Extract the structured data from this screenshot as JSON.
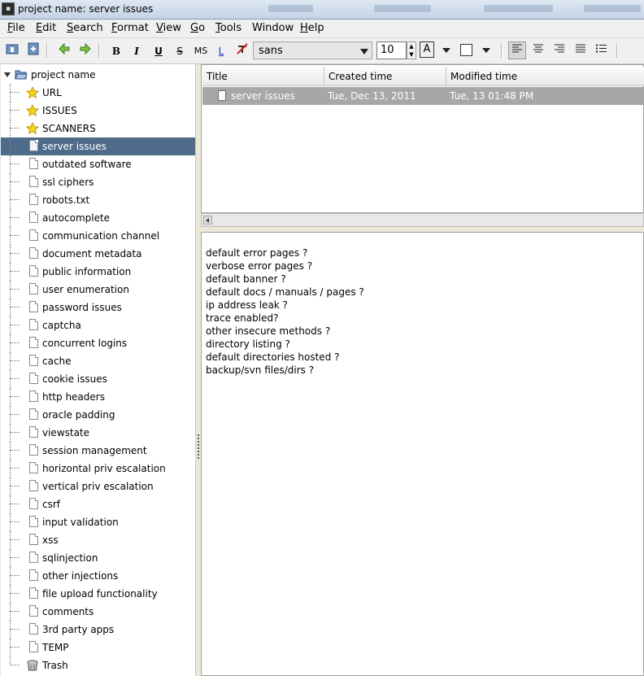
{
  "window": {
    "title": "project name: server issues"
  },
  "menu": [
    {
      "accel": "F",
      "rest": "ile"
    },
    {
      "accel": "E",
      "rest": "dit"
    },
    {
      "accel": "S",
      "rest": "earch"
    },
    {
      "accel": "F",
      "rest": "ormat",
      "prefix": ""
    },
    {
      "accel": "V",
      "rest": "iew"
    },
    {
      "accel": "G",
      "rest": "o"
    },
    {
      "accel": "T",
      "rest": "ools"
    },
    {
      "accel": "",
      "rest": "Window"
    },
    {
      "accel": "H",
      "rest": "elp"
    }
  ],
  "toolbar": {
    "bold": "B",
    "italic": "I",
    "underline": "U",
    "strike": "S",
    "mono": "MS",
    "link": "L",
    "font": "sans",
    "size": "10",
    "text_color": "A"
  },
  "tree": {
    "root": "project name",
    "items": [
      {
        "label": "URL",
        "icon": "star-icon"
      },
      {
        "label": "ISSUES",
        "icon": "star-icon"
      },
      {
        "label": "SCANNERS",
        "icon": "star-icon"
      },
      {
        "label": "server issues",
        "icon": "page-icon",
        "selected": true
      },
      {
        "label": "outdated software",
        "icon": "page-icon"
      },
      {
        "label": "ssl ciphers",
        "icon": "page-icon"
      },
      {
        "label": "robots.txt",
        "icon": "page-icon"
      },
      {
        "label": "autocomplete",
        "icon": "page-icon"
      },
      {
        "label": "communication channel",
        "icon": "page-icon"
      },
      {
        "label": "document metadata",
        "icon": "page-icon"
      },
      {
        "label": "public information",
        "icon": "page-icon"
      },
      {
        "label": "user enumeration",
        "icon": "page-icon"
      },
      {
        "label": "password issues",
        "icon": "page-icon"
      },
      {
        "label": "captcha",
        "icon": "page-icon"
      },
      {
        "label": "concurrent logins",
        "icon": "page-icon"
      },
      {
        "label": "cache",
        "icon": "page-icon"
      },
      {
        "label": "cookie issues",
        "icon": "page-icon"
      },
      {
        "label": "http headers",
        "icon": "page-icon"
      },
      {
        "label": "oracle padding",
        "icon": "page-icon"
      },
      {
        "label": "viewstate",
        "icon": "page-icon"
      },
      {
        "label": "session management",
        "icon": "page-icon"
      },
      {
        "label": "horizontal priv escalation",
        "icon": "page-icon"
      },
      {
        "label": "vertical priv escalation",
        "icon": "page-icon"
      },
      {
        "label": "csrf",
        "icon": "page-icon"
      },
      {
        "label": "input validation",
        "icon": "page-icon"
      },
      {
        "label": "xss",
        "icon": "page-icon"
      },
      {
        "label": "sqlinjection",
        "icon": "page-icon"
      },
      {
        "label": "other injections",
        "icon": "page-icon"
      },
      {
        "label": "file upload functionality",
        "icon": "page-icon"
      },
      {
        "label": "comments",
        "icon": "page-icon"
      },
      {
        "label": "3rd party apps",
        "icon": "page-icon"
      },
      {
        "label": "TEMP",
        "icon": "page-icon"
      },
      {
        "label": "Trash",
        "icon": "trash-icon"
      }
    ]
  },
  "list": {
    "headers": [
      "Title",
      "Created time",
      "Modified time"
    ],
    "row": {
      "title": "server issues",
      "created": "Tue, Dec 13, 2011",
      "modified": "Tue, 13 01:48 PM"
    }
  },
  "editor": {
    "lines": [
      "default error pages ?",
      "verbose error pages ?",
      "default banner ?",
      "default docs / manuals / pages ?",
      "ip address leak ?",
      "trace enabled?",
      "other insecure methods ?",
      "directory listing ?",
      "default directories hosted ?",
      "backup/svn files/dirs ?"
    ]
  }
}
